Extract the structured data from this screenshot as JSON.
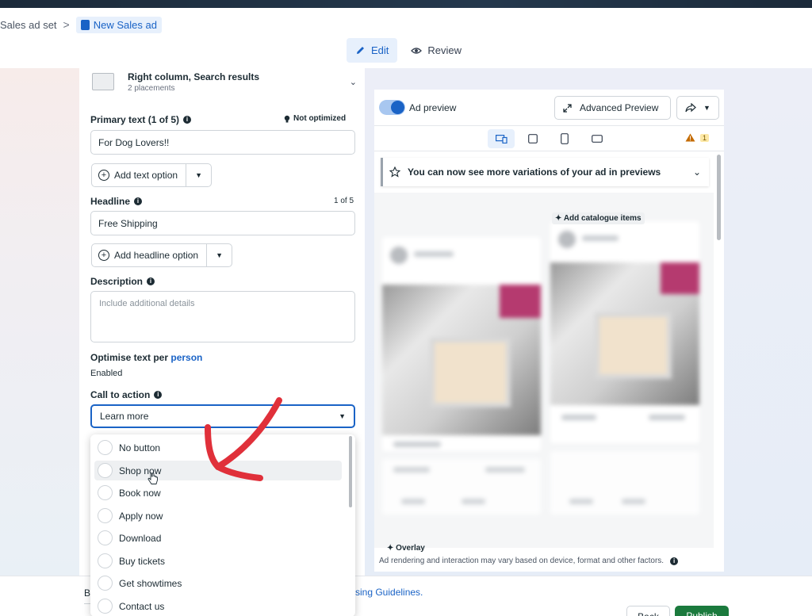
{
  "breadcrumb": {
    "parent": "Sales ad set",
    "separator": ">",
    "current": "New Sales ad"
  },
  "mode_tabs": {
    "edit": "Edit",
    "review": "Review",
    "active": "edit"
  },
  "placement": {
    "title": "Right column, Search results",
    "subtitle": "2 placements"
  },
  "primary_text": {
    "label": "Primary text (1 of 5)",
    "status": "Not optimized",
    "value": "For Dog Lovers!!",
    "add_option": "Add text option"
  },
  "headline": {
    "label": "Headline",
    "counter": "1 of 5",
    "value": "Free Shipping",
    "add_option": "Add headline option"
  },
  "description": {
    "label": "Description",
    "placeholder": "Include additional details"
  },
  "optimise": {
    "label_prefix": "Optimise text per ",
    "label_link": "person",
    "status": "Enabled"
  },
  "cta": {
    "label": "Call to action",
    "selected": "Learn more",
    "options": [
      "No button",
      "Shop now",
      "Book now",
      "Apply now",
      "Download",
      "Buy tickets",
      "Get showtimes",
      "Contact us"
    ],
    "hovered_index": 1
  },
  "preview": {
    "toggle_label": "Ad preview",
    "advanced_button": "Advanced Preview",
    "warning_count": "1",
    "notice": "You can now see more variations of your ad in previews",
    "add_catalogue": "Add catalogue items",
    "overlay": "Overlay",
    "footer": "Ad rendering and interaction may vary based on device, format and other factors."
  },
  "bottom": {
    "left_text": "B",
    "guidelines_link": "rtising Guidelines.",
    "back": "Back",
    "publish": "Publish"
  },
  "colors": {
    "accent": "#1a63c6",
    "publish": "#1b7a3d",
    "annotation": "#e0303a"
  }
}
